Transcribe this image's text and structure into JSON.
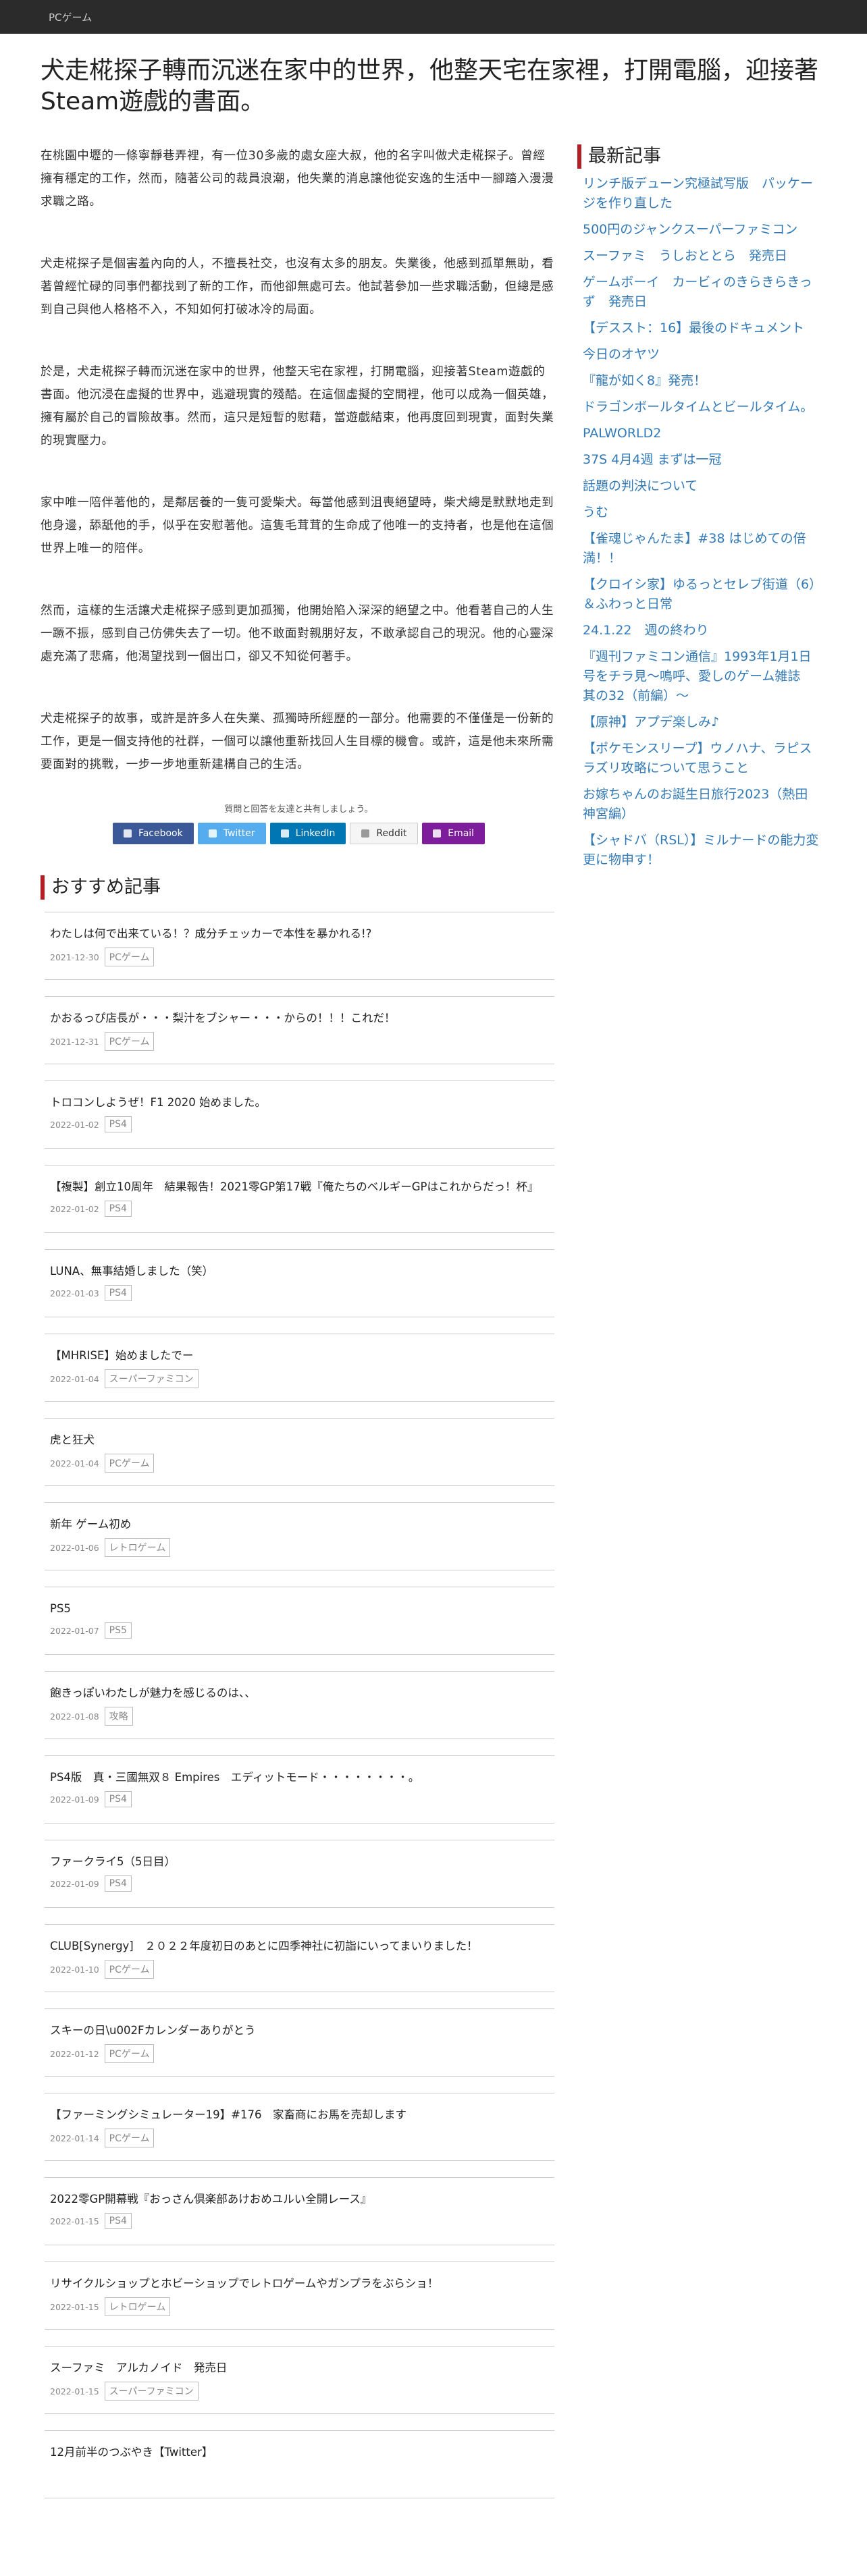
{
  "topbar": {
    "label": "PCゲーム"
  },
  "article": {
    "title": "犬走椛探子轉而沉迷在家中的世界，他整天宅在家裡，打開電腦，迎接著Steam遊戲的書面。",
    "paragraphs": [
      "在桃園中壢的一條寧靜巷弄裡，有一位30多歲的處女座大叔，他的名字叫做犬走椛探子。曾經擁有穩定的工作，然而，隨著公司的裁員浪潮，他失業的消息讓他從安逸的生活中一腳踏入漫漫求職之路。",
      "犬走椛探子是個害羞內向的人，不擅長社交，也沒有太多的朋友。失業後，他感到孤單無助，看著曾經忙碌的同事們都找到了新的工作，而他卻無處可去。他試著參加一些求職活動，但總是感到自己與他人格格不入，不知如何打破冰冷的局面。",
      "於是，犬走椛探子轉而沉迷在家中的世界，他整天宅在家裡，打開電腦，迎接著Steam遊戲的書面。他沉浸在虛擬的世界中，逃避現實的殘酷。在這個虛擬的空間裡，他可以成為一個英雄，擁有屬於自己的冒險故事。然而，這只是短暫的慰藉，當遊戲結束，他再度回到現實，面對失業的現實壓力。",
      "家中唯一陪伴著他的，是鄰居養的一隻可愛柴犬。每當他感到沮喪絕望時，柴犬總是默默地走到他身邊，舔舐他的手，似乎在安慰著他。這隻毛茸茸的生命成了他唯一的支持者，也是他在這個世界上唯一的陪伴。",
      "然而，這樣的生活讓犬走椛探子感到更加孤獨，他開始陷入深深的絕望之中。他看著自己的人生一蹶不振，感到自己仿佛失去了一切。他不敢面對親朋好友，不敢承認自己的現況。他的心靈深處充滿了悲痛，他渴望找到一個出口，卻又不知從何著手。",
      "犬走椛探子的故事，或許是許多人在失業、孤獨時所經歷的一部分。他需要的不僅僅是一份新的工作，更是一個支持他的社群，一個可以讓他重新找回人生目標的機會。或許，這是他未來所需要面對的挑戰，一步一步地重新建構自己的生活。"
    ]
  },
  "share": {
    "note": "質問と回答を友達と共有しましょう。",
    "buttons": [
      {
        "label": "Facebook",
        "icon": "facebook-icon"
      },
      {
        "label": "Twitter",
        "icon": "twitter-icon"
      },
      {
        "label": "LinkedIn",
        "icon": "linkedin-icon"
      },
      {
        "label": "Reddit",
        "icon": "reddit-icon"
      },
      {
        "label": "Email",
        "icon": "email-icon"
      }
    ]
  },
  "recommended": {
    "heading": "おすすめ記事",
    "items": [
      {
        "title": "わたしは何で出来ている！？成分チェッカーで本性を暴かれる!?",
        "date": "2021-12-30",
        "tag": "PCゲーム"
      },
      {
        "title": "かおるっぴ店長が・・・梨汁をブシャー・・・からの！！！これだ！",
        "date": "2021-12-31",
        "tag": "PCゲーム"
      },
      {
        "title": "トロコンしようぜ！F1 2020 始めました。",
        "date": "2022-01-02",
        "tag": "PS4"
      },
      {
        "title": "【複製】創立10周年　結果報告！2021零GP第17戦『俺たちのベルギーGPはこれからだっ！杯』",
        "date": "2022-01-02",
        "tag": "PS4"
      },
      {
        "title": "LUNA、無事結婚しました（笑）",
        "date": "2022-01-03",
        "tag": "PS4"
      },
      {
        "title": "【MHRISE】始めましたでー",
        "date": "2022-01-04",
        "tag": "スーパーファミコン"
      },
      {
        "title": "虎と狂犬",
        "date": "2022-01-04",
        "tag": "PCゲーム"
      },
      {
        "title": "新年 ゲーム初め",
        "date": "2022-01-06",
        "tag": "レトロゲーム"
      },
      {
        "title": "PS5",
        "date": "2022-01-07",
        "tag": "PS5"
      },
      {
        "title": "飽きっぽいわたしが魅力を感じるのは、、",
        "date": "2022-01-08",
        "tag": "攻略"
      },
      {
        "title": "PS4版　真・三國無双８ Empires　エディットモード・・・・・・・・。",
        "date": "2022-01-09",
        "tag": "PS4"
      },
      {
        "title": "ファークライ5（5日目）",
        "date": "2022-01-09",
        "tag": "PS4"
      },
      {
        "title": "CLUB[Synergy]　２０２２年度初日のあとに四季神社に初詣にいってまいりました！",
        "date": "2022-01-10",
        "tag": "PCゲーム"
      },
      {
        "title": "スキーの日\\u002Fカレンダーありがとう",
        "date": "2022-01-12",
        "tag": "PCゲーム"
      },
      {
        "title": "【ファーミングシミュレーター19】#176　家畜商にお馬を売却します",
        "date": "2022-01-14",
        "tag": "PCゲーム"
      },
      {
        "title": "2022零GP開幕戦『おっさん倶楽部あけおめユルい全開レース』",
        "date": "2022-01-15",
        "tag": "PS4"
      },
      {
        "title": "リサイクルショップとホビーショップでレトロゲームやガンプラをぶらショ！",
        "date": "2022-01-15",
        "tag": "レトロゲーム"
      },
      {
        "title": "スーファミ　アルカノイド　発売日",
        "date": "2022-01-15",
        "tag": "スーパーファミコン"
      },
      {
        "title": "12月前半のつぶやき【Twitter】",
        "date": "",
        "tag": ""
      }
    ]
  },
  "sidebar": {
    "heading": "最新記事",
    "items": [
      "リンチ版デューン究極試写版　パッケージを作り直した",
      "500円のジャンクスーパーファミコン",
      "スーファミ　うしおととら　発売日",
      "ゲームボーイ　カービィのきらきらきっず　発売日",
      "【デススト：16】最後のドキュメント",
      "今日のオヤツ",
      "『龍が如く8』発売！",
      "ドラゴンボールタイムとビールタイム。",
      "PALWORLD2",
      "37S 4月4週 まずは一冠",
      "話題の判決について",
      "うむ",
      "【雀魂じゃんたま】#38 はじめての倍満！！",
      "【クロイシ家】ゆるっとセレブ街道（6）＆ふわっと日常",
      "24.1.22　週の終わり",
      "『週刊ファミコン通信』1993年1月1日号をチラ見〜鳴呼、愛しのゲーム雑誌　其の32（前編）〜",
      "【原神】アプデ楽しみ♪",
      "【ポケモンスリープ】ウノハナ、ラピスラズリ攻略について思うこと",
      "お嫁ちゃんのお誕生日旅行2023（熱田神宮編）",
      "【シャドバ（RSL）】ミルナードの能力変更に物申す！"
    ]
  }
}
